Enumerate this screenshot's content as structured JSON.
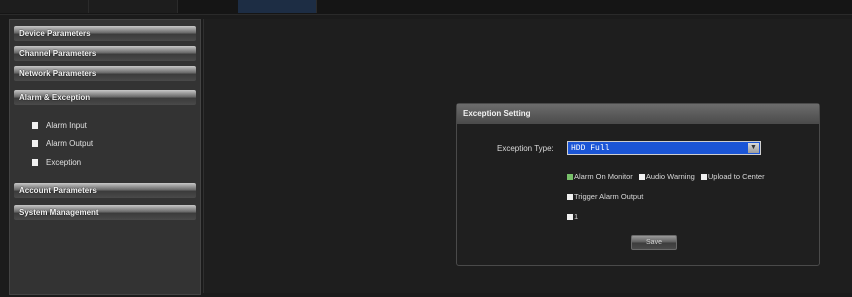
{
  "sidebar": {
    "categories": [
      "Device Parameters",
      "Channel Parameters",
      "Network Parameters",
      "Alarm & Exception",
      "Account Parameters",
      "System Management"
    ],
    "alarm_items": [
      "Alarm Input",
      "Alarm Output",
      "Exception"
    ]
  },
  "panel": {
    "title": "Exception Setting",
    "exception_type_label": "Exception Type:",
    "exception_type_value": "HDD Full",
    "checkboxes": [
      {
        "label": "Alarm On Monitor",
        "checked": true
      },
      {
        "label": "Audio Warning",
        "checked": false
      },
      {
        "label": "Upload to Center",
        "checked": false
      },
      {
        "label": "Trigger Alarm Output",
        "checked": false
      },
      {
        "label": "1",
        "checked": false
      }
    ],
    "save_label": "Save"
  },
  "colors": {
    "select_bg": "#1b55d6",
    "checked_box": "#78c06a",
    "panel_header": "#5a5a5a"
  }
}
